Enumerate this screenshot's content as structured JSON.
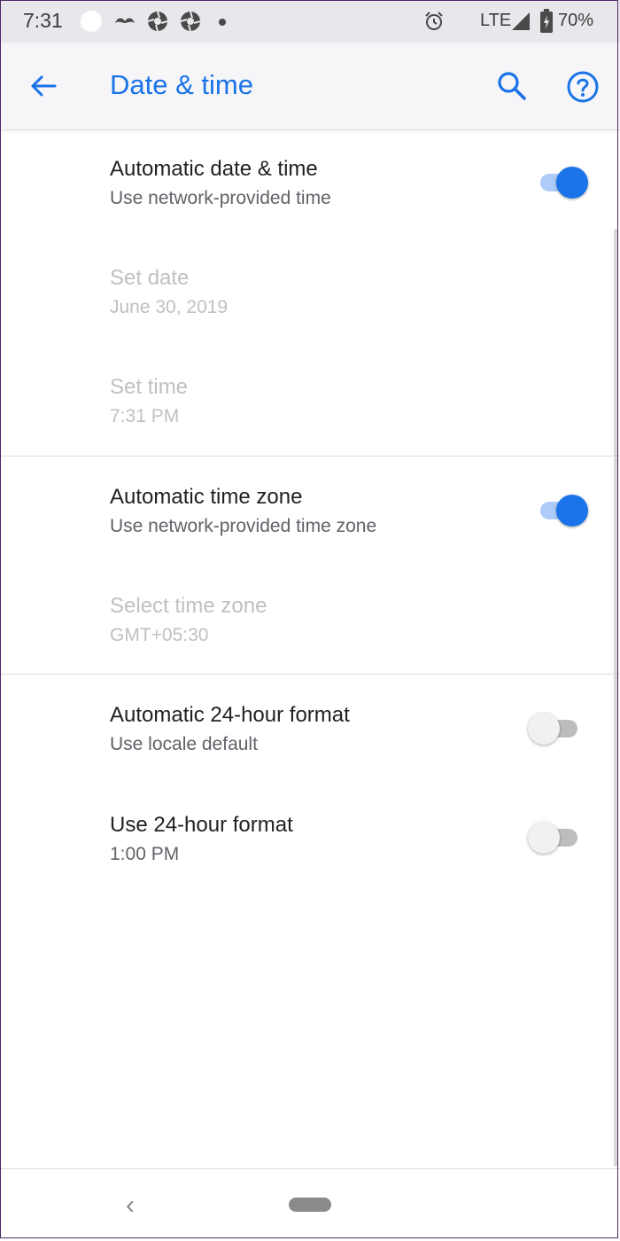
{
  "status_bar": {
    "time": "7:31",
    "network": "LTE",
    "battery": "70%",
    "icons": [
      "circle-icon",
      "mustache-icon",
      "aperture-icon",
      "aperture-icon",
      "dot-icon",
      "alarm-icon",
      "signal-icon",
      "battery-charging-icon"
    ]
  },
  "app_bar": {
    "title": "Date & time",
    "back_icon": "arrow-back-icon",
    "search_icon": "search-icon",
    "help_icon": "help-icon"
  },
  "settings": {
    "auto_date_time": {
      "title": "Automatic date & time",
      "subtitle": "Use network-provided time",
      "enabled": true
    },
    "set_date": {
      "title": "Set date",
      "subtitle": "June 30, 2019",
      "disabled": true
    },
    "set_time": {
      "title": "Set time",
      "subtitle": "7:31 PM",
      "disabled": true
    },
    "auto_time_zone": {
      "title": "Automatic time zone",
      "subtitle": "Use network-provided time zone",
      "enabled": true
    },
    "select_time_zone": {
      "title": "Select time zone",
      "subtitle": "GMT+05:30",
      "disabled": true
    },
    "auto_24h": {
      "title": "Automatic 24-hour format",
      "subtitle": "Use locale default",
      "enabled": false
    },
    "use_24h": {
      "title": "Use 24-hour format",
      "subtitle": "1:00 PM",
      "enabled": false
    }
  },
  "colors": {
    "accent": "#1a73e8",
    "accent_light": "#aecbfa",
    "disabled_text": "#c0c0c0"
  },
  "nav_bar": {
    "back": "‹"
  }
}
